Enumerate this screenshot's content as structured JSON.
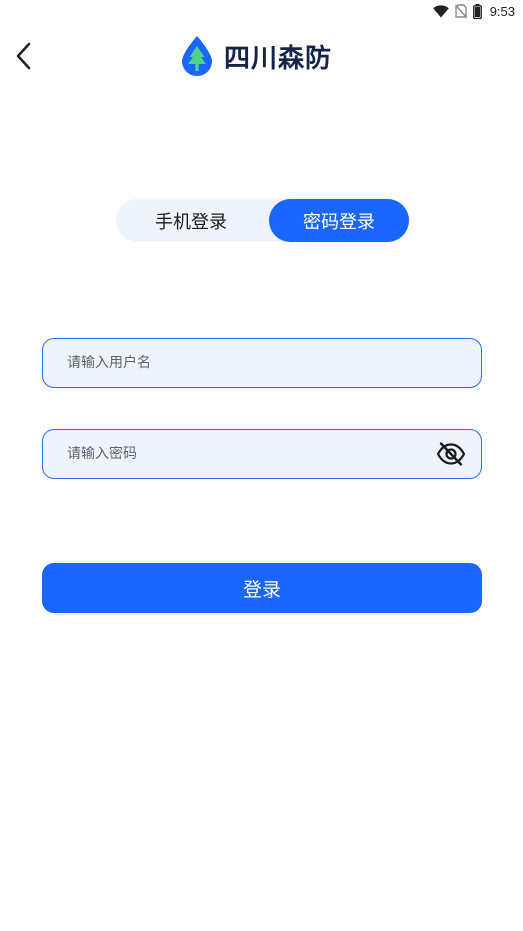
{
  "status_bar": {
    "time": "9:53",
    "icons": [
      "wifi-icon",
      "no-sim-icon",
      "battery-icon"
    ]
  },
  "header": {
    "title": "四川森防",
    "logo": "tree-drop-logo",
    "back_icon": "chevron-left-icon"
  },
  "tabs": [
    {
      "label": "手机登录",
      "active": false
    },
    {
      "label": "密码登录",
      "active": true
    }
  ],
  "form": {
    "username": {
      "value": "",
      "placeholder": "请输入用户名"
    },
    "password": {
      "value": "",
      "placeholder": "请输入密码",
      "toggle_icon": "eye-off-icon"
    },
    "submit_label": "登录"
  },
  "colors": {
    "accent": "#1a66ff",
    "field_bg": "#eef3fd",
    "title": "#14234a",
    "logo_green": "#4fd18b"
  }
}
